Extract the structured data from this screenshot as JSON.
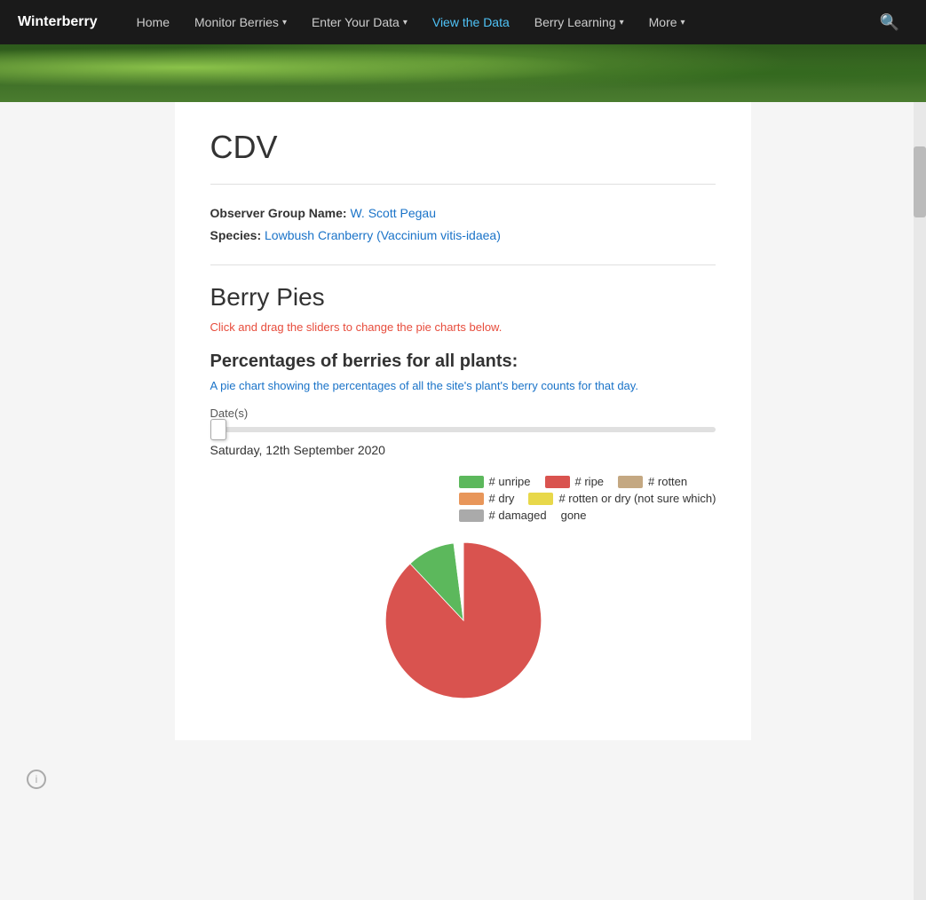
{
  "nav": {
    "brand": "Winterberry",
    "items": [
      {
        "label": "Home",
        "active": false,
        "hasDropdown": false
      },
      {
        "label": "Monitor Berries",
        "active": false,
        "hasDropdown": true
      },
      {
        "label": "Enter Your Data",
        "active": false,
        "hasDropdown": true
      },
      {
        "label": "View the Data",
        "active": true,
        "hasDropdown": false
      },
      {
        "label": "Berry Learning",
        "active": false,
        "hasDropdown": true
      },
      {
        "label": "More",
        "active": false,
        "hasDropdown": true
      }
    ]
  },
  "page": {
    "title": "CDV",
    "observer_label": "Observer Group Name:",
    "observer_value": "W. Scott Pegau",
    "species_label": "Species:",
    "species_value": "Lowbush Cranberry (Vaccinium vitis-idaea)",
    "section_title": "Berry Pies",
    "section_subtitle_static": "Click and drag the sliders to ",
    "section_subtitle_link": "change the pie charts below.",
    "subsection_title": "Percentages of berries for all plants:",
    "subsection_desc_static": "A pie chart showing the percentages of ",
    "subsection_desc_link": "all the site's plant's berry counts for that day.",
    "date_label": "Date(s)",
    "date_display": "Saturday, 12th September 2020"
  },
  "legend": {
    "rows": [
      [
        {
          "color": "#5cb85c",
          "label": "# unripe"
        },
        {
          "color": "#d9534f",
          "label": "# ripe"
        },
        {
          "color": "#c4a882",
          "label": "# rotten"
        }
      ],
      [
        {
          "color": "#e8965a",
          "label": "# dry"
        },
        {
          "color": "#e8d84a",
          "label": "# rotten or dry (not sure which)"
        }
      ],
      [
        {
          "color": "#aaa",
          "label": "# damaged"
        },
        {
          "color": null,
          "label": "gone"
        }
      ]
    ]
  },
  "pie": {
    "slices": [
      {
        "color": "#d9534f",
        "percent": 88,
        "label": "ripe"
      },
      {
        "color": "#5cb85c",
        "percent": 10,
        "label": "unripe"
      },
      {
        "color": "#ffffff",
        "percent": 2,
        "label": "gap"
      }
    ]
  },
  "colors": {
    "brand": "#1a1a1a",
    "active_nav": "#4fc3f7",
    "link": "#1a73c8",
    "red_link": "#e74c3c"
  }
}
